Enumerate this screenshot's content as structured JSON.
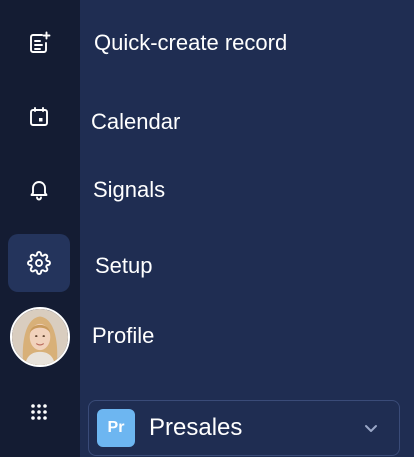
{
  "menu": {
    "items": [
      {
        "label": "Quick-create record",
        "icon": "quick-create-icon"
      },
      {
        "label": "Calendar",
        "icon": "calendar-icon"
      },
      {
        "label": "Signals",
        "icon": "bell-icon"
      },
      {
        "label": "Setup",
        "icon": "gear-icon"
      },
      {
        "label": "Profile",
        "icon": "avatar"
      }
    ]
  },
  "apps": {
    "icon": "app-grid-icon"
  },
  "org_switcher": {
    "badge": "Pr",
    "name": "Presales",
    "icon": "chevron-down-icon"
  },
  "colors": {
    "rail_bg": "#141c33",
    "panel_bg": "#1f2d52",
    "active_bg": "#24345c",
    "badge_bg": "#6db6f1",
    "text": "#ffffff"
  }
}
